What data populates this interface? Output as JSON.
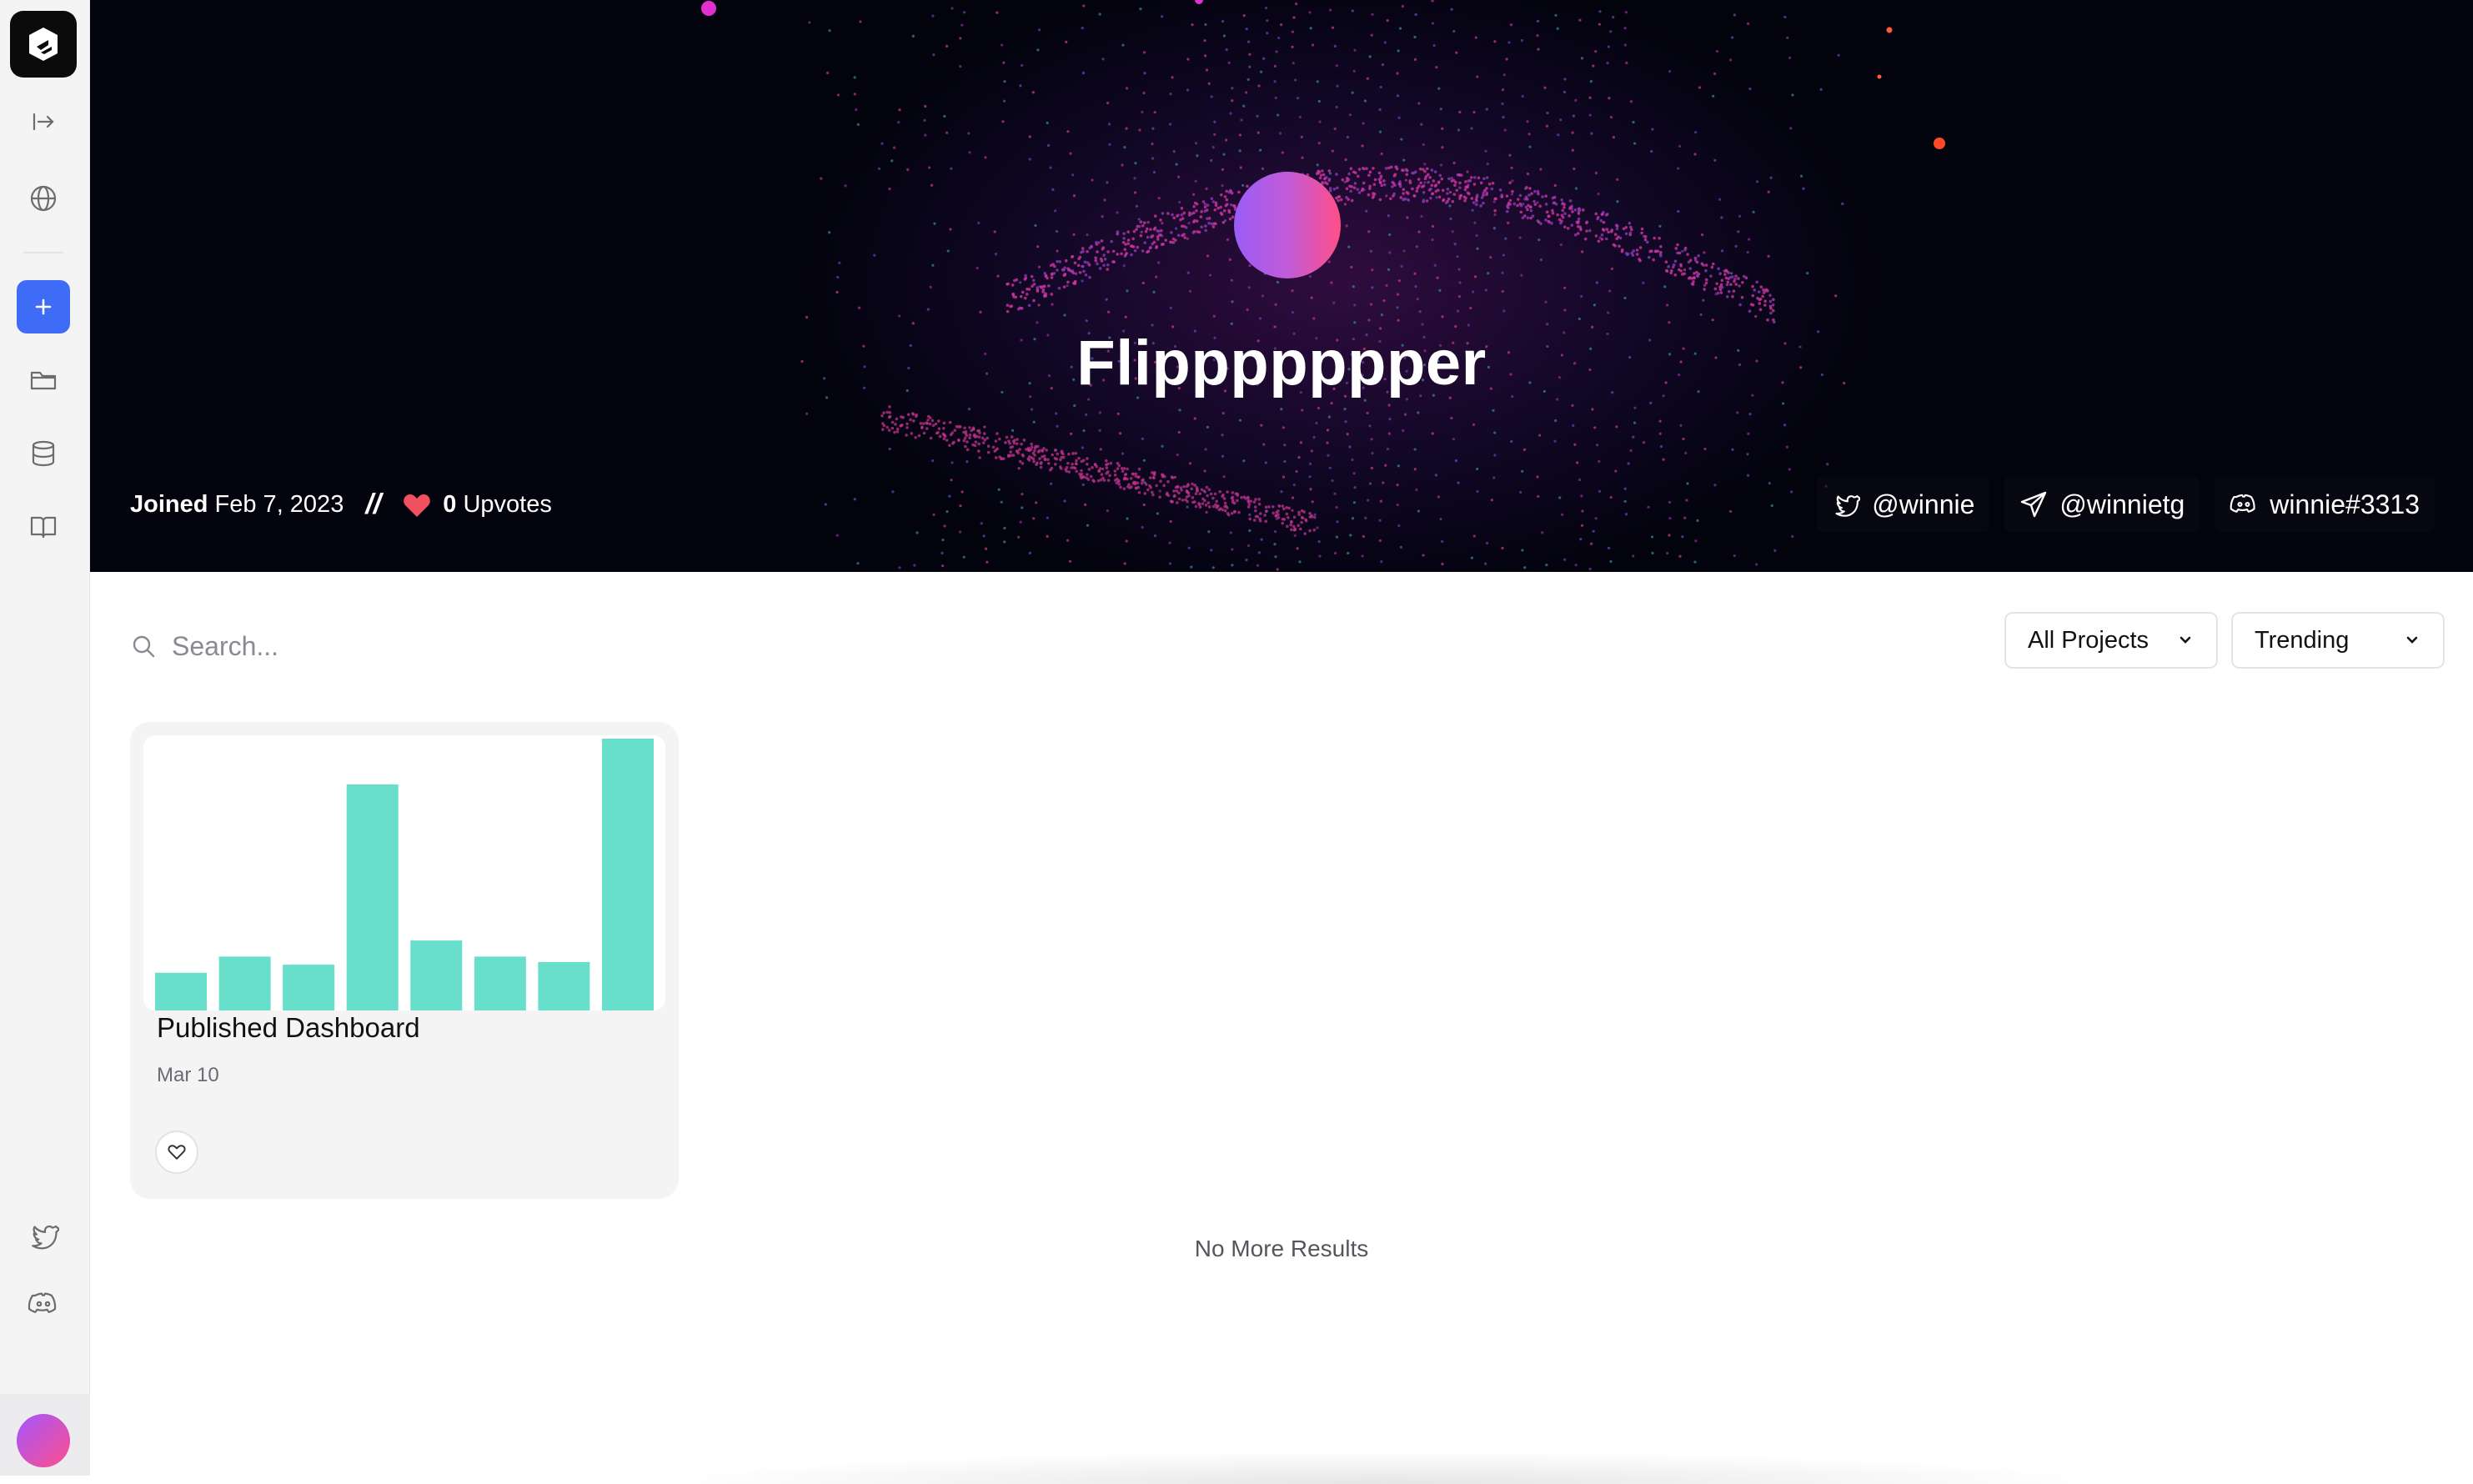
{
  "sidebar": {
    "items": [
      {
        "name": "collapse",
        "icon": "arrow-right-to-line-icon"
      },
      {
        "name": "explore",
        "icon": "globe-icon"
      },
      {
        "name": "new",
        "icon": "plus-icon"
      },
      {
        "name": "projects",
        "icon": "folder-icon"
      },
      {
        "name": "data",
        "icon": "database-icon"
      },
      {
        "name": "docs",
        "icon": "book-icon"
      },
      {
        "name": "twitter",
        "icon": "twitter-icon"
      },
      {
        "name": "discord",
        "icon": "discord-icon"
      }
    ],
    "accent_color": "#3f6cf6"
  },
  "profile": {
    "name": "Flippppppper",
    "joined_label": "Joined",
    "joined_date": "Feb 7, 2023",
    "separator": "//",
    "upvotes_count": "0",
    "upvotes_label": "Upvotes",
    "twitter": "@winnie",
    "telegram": "@winnietg",
    "discord": "winnie#3313"
  },
  "search": {
    "placeholder": "Search..."
  },
  "filters": {
    "projects": {
      "selected": "All Projects"
    },
    "sort": {
      "selected": "Trending"
    }
  },
  "projects": [
    {
      "title": "Published Dashboard",
      "date": "Mar 10",
      "chart_color": "#67dfca",
      "chart_data": {
        "type": "bar",
        "values": [
          14,
          20,
          17,
          84,
          26,
          20,
          18,
          101
        ],
        "ylim": [
          0,
          101
        ]
      }
    }
  ],
  "footer": {
    "no_more": "No More Results"
  }
}
